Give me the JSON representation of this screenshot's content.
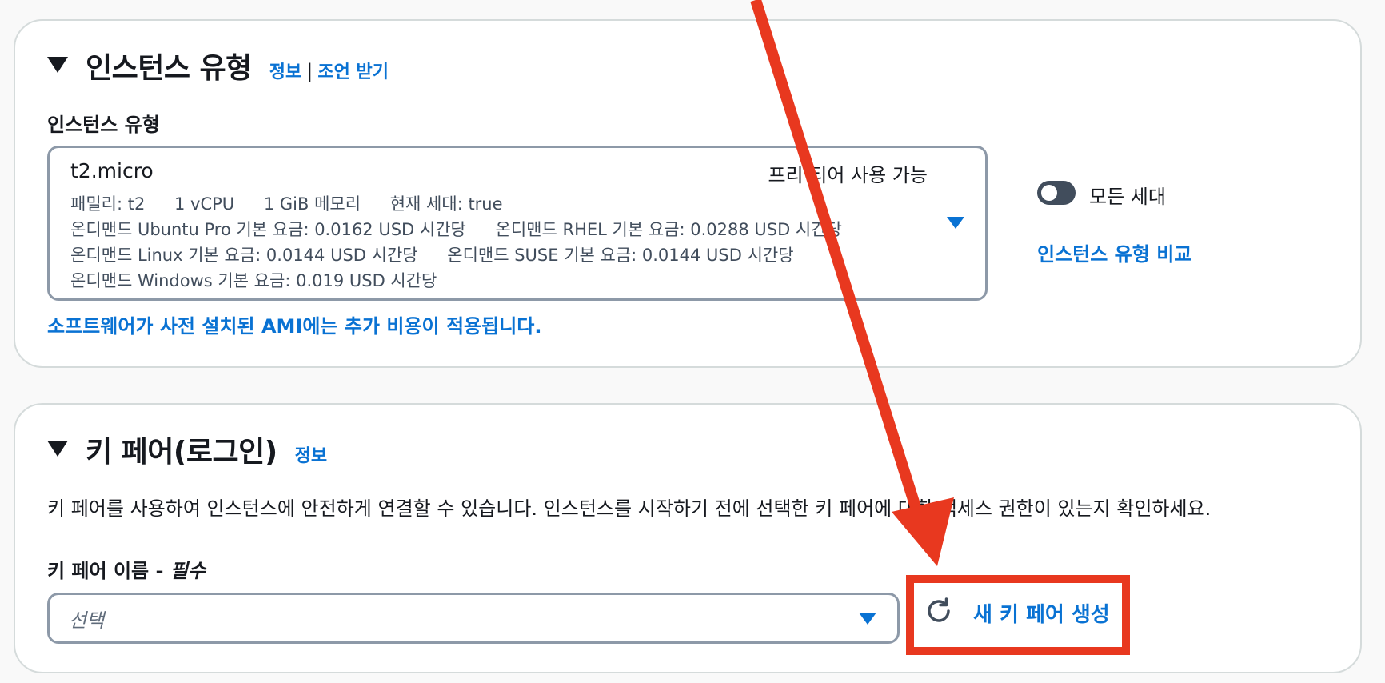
{
  "instance_type_section": {
    "title": "인스턴스 유형",
    "info_link": "정보",
    "separator": "|",
    "advice_link": "조언 받기",
    "field_label": "인스턴스 유형",
    "selected": {
      "name": "t2.micro",
      "free_tier": "프리 티어 사용 가능",
      "details": [
        "패밀리: t2",
        "1 vCPU",
        "1 GiB 메모리",
        "현재 세대: true"
      ],
      "pricing_row1": [
        "온디맨드 Ubuntu Pro 기본 요금: 0.0162 USD 시간당",
        "온디맨드 RHEL 기본 요금: 0.0288 USD 시간당"
      ],
      "pricing_row2": [
        "온디맨드 Linux 기본 요금: 0.0144 USD 시간당",
        "온디맨드 SUSE 기본 요금: 0.0144 USD 시간당"
      ],
      "pricing_row3": "온디맨드 Windows 기본 요금: 0.019 USD 시간당"
    },
    "all_generations_toggle": {
      "label": "모든 세대",
      "on": false
    },
    "compare_link": "인스턴스 유형 비교",
    "ami_note_link": "소프트웨어가 사전 설치된 AMI에는 추가 비용이 적용됩니다."
  },
  "key_pair_section": {
    "title": "키 페어(로그인)",
    "info_link": "정보",
    "description": "키 페어를 사용하여 인스턴스에 안전하게 연결할 수 있습니다. 인스턴스를 시작하기 전에 선택한 키 페어에 대한 액세스 권한이 있는지 확인하세요.",
    "name_label": "키 페어 이름 - ",
    "required_label": "필수",
    "select_placeholder": "선택",
    "refresh_icon": "refresh-icon",
    "create_link": "새 키 페어 생성"
  },
  "annotation_color": "#e8381f",
  "accent_color": "#0972d3"
}
